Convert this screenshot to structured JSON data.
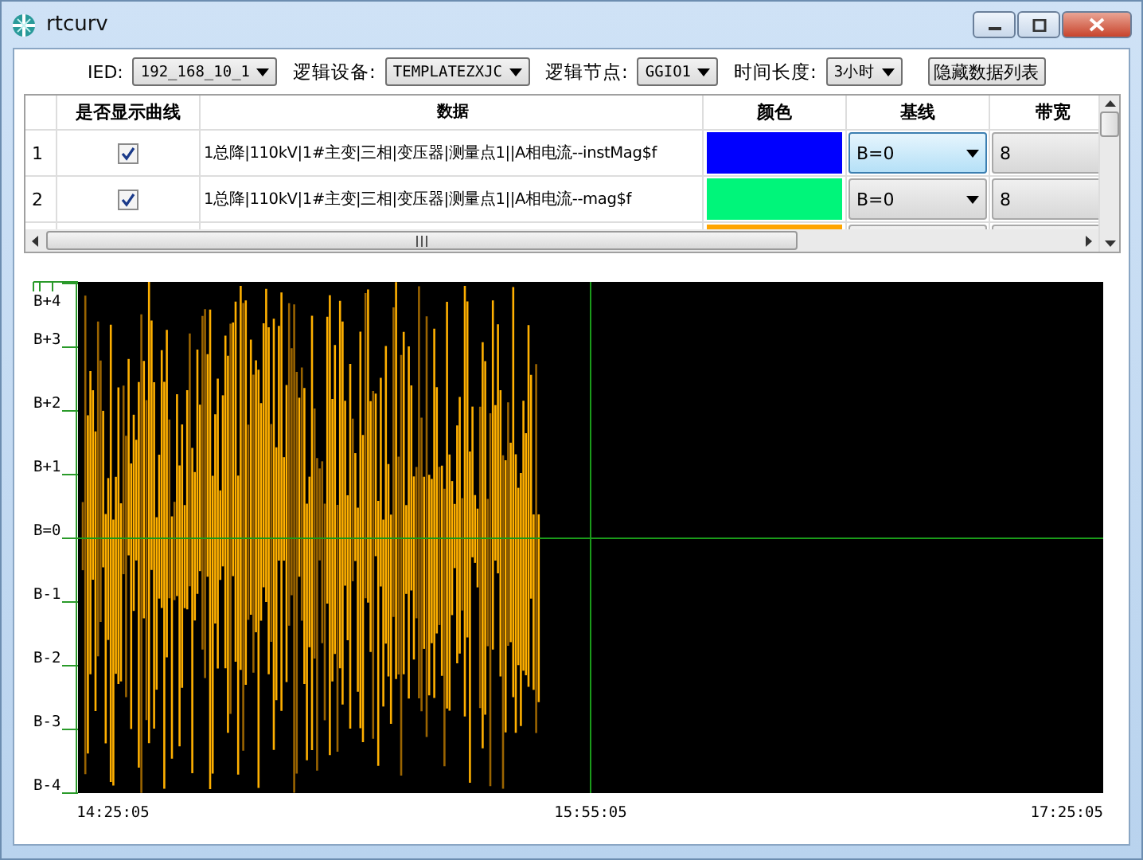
{
  "window": {
    "title": "rtcurv"
  },
  "toolbar": {
    "fields": [
      {
        "label": "IED:",
        "value": "192_168_10_1"
      },
      {
        "label": "逻辑设备:",
        "value": "TEMPLATEZXJC"
      },
      {
        "label": "逻辑节点:",
        "value": "GGIO1"
      },
      {
        "label": "时间长度:",
        "value": "3小时"
      }
    ],
    "button": "隐藏数据列表"
  },
  "table": {
    "columns": [
      "是否显示曲线",
      "数据",
      "颜色",
      "基线",
      "带宽"
    ],
    "rows": [
      {
        "number": "1",
        "checked": true,
        "data": "1总降|110kV|1#主变|三相|变压器|测量点1||A相电流--instMag$f",
        "color": "#0000ff",
        "baseline": "B=0",
        "baseline_focused": true,
        "bandwidth": "8"
      },
      {
        "number": "2",
        "checked": true,
        "data": "1总降|110kV|1#主变|三相|变压器|测量点1||A相电流--mag$f",
        "color": "#00f57a",
        "baseline": "B=0",
        "baseline_focused": false,
        "bandwidth": "8"
      },
      {
        "color": "#ffa500"
      }
    ]
  },
  "plot": {
    "y_labels": [
      "B+4",
      "B+3",
      "B+2",
      "B+1",
      "B=0",
      "B-1",
      "B-2",
      "B-3",
      "B-4"
    ],
    "x_labels": [
      "14:25:05",
      "15:55:05",
      "17:25:05"
    ]
  }
}
